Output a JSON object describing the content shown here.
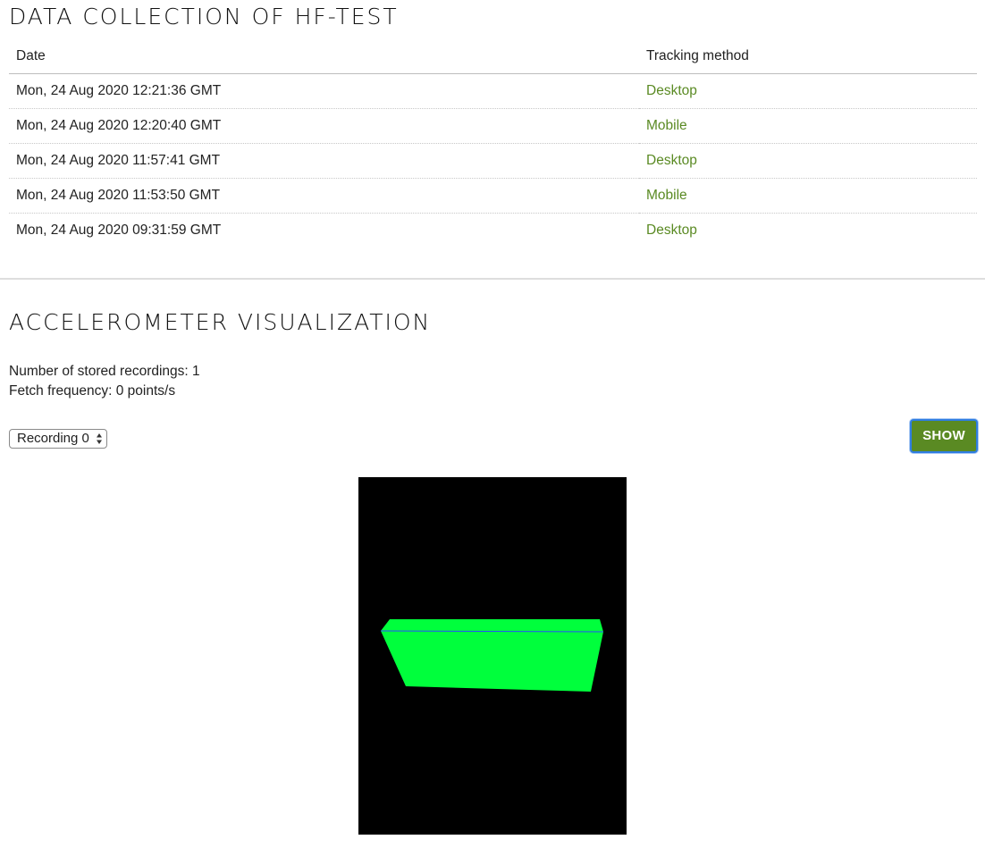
{
  "data_section": {
    "title": "DATA COLLECTION OF HF-TEST",
    "columns": [
      "Date",
      "Tracking method"
    ],
    "rows": [
      {
        "date": "Mon, 24 Aug 2020 12:21:36 GMT",
        "method": "Desktop"
      },
      {
        "date": "Mon, 24 Aug 2020 12:20:40 GMT",
        "method": "Mobile"
      },
      {
        "date": "Mon, 24 Aug 2020 11:57:41 GMT",
        "method": "Desktop"
      },
      {
        "date": "Mon, 24 Aug 2020 11:53:50 GMT",
        "method": "Mobile"
      },
      {
        "date": "Mon, 24 Aug 2020 09:31:59 GMT",
        "method": "Desktop"
      }
    ]
  },
  "accel_section": {
    "title": "ACCELEROMETER VISUALIZATION",
    "recordings_line": "Number of stored recordings: 1",
    "frequency_line": "Fetch frequency: 0 points/s",
    "select_value": "Recording 0",
    "show_label": "SHOW"
  },
  "colors": {
    "accent_green": "#5a8a23",
    "box_face": "#00ff3c",
    "box_edge": "#2b4bff",
    "canvas_bg": "#000000"
  },
  "icons": {
    "select_arrows": "up-down-arrows-icon"
  }
}
